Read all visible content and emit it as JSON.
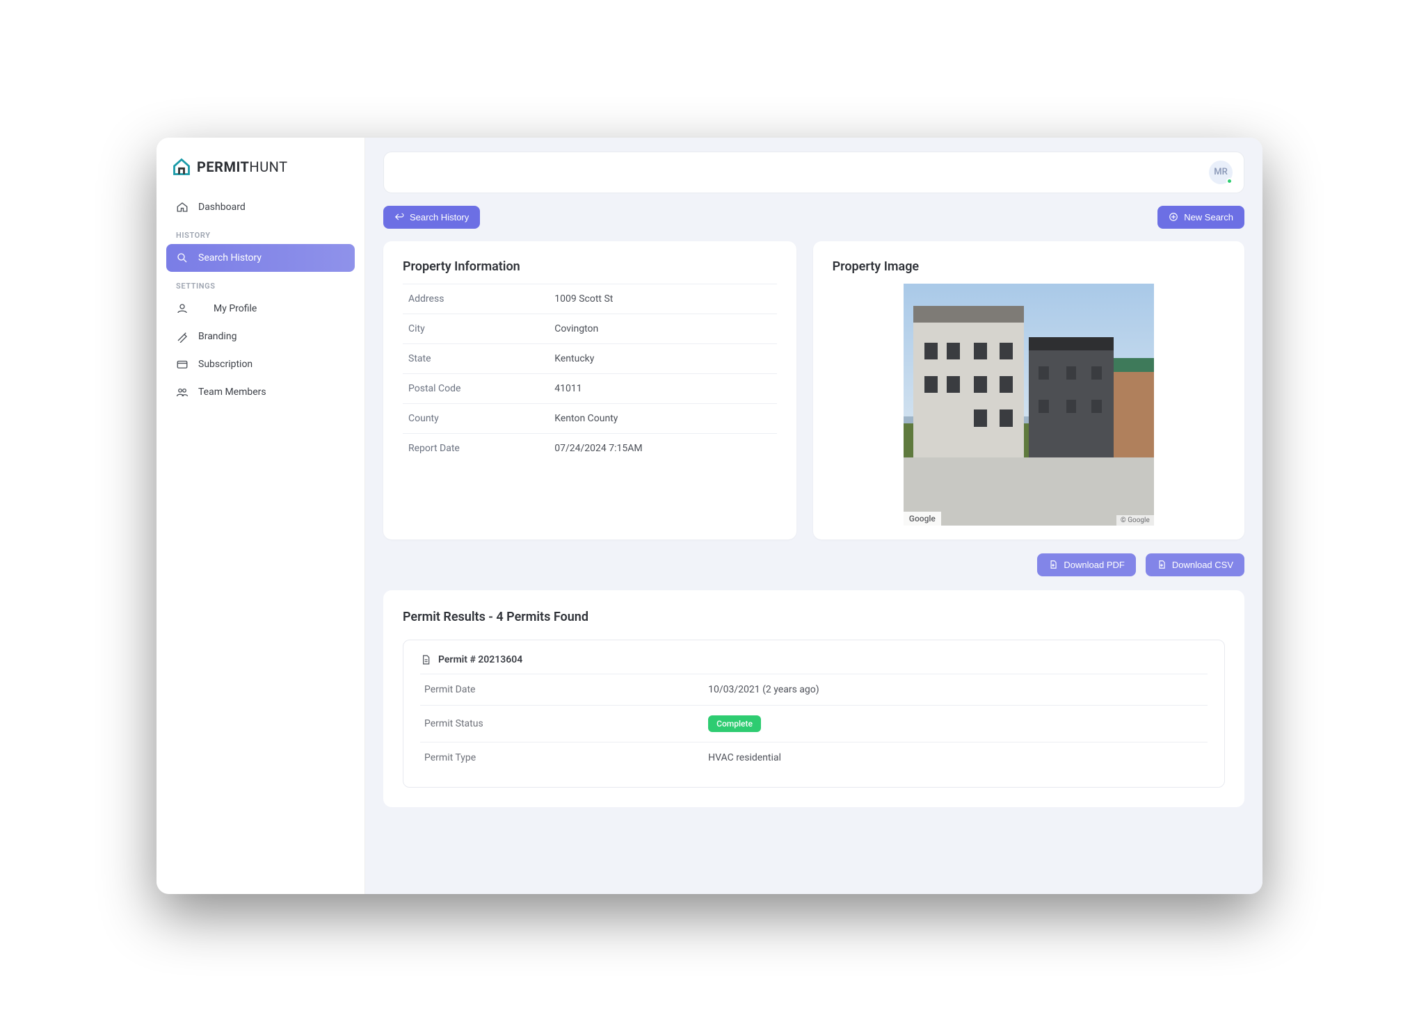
{
  "brand": {
    "name_bold": "PERMIT",
    "name_thin": "HUNT"
  },
  "avatar": {
    "initials": "MR"
  },
  "nav": {
    "dashboard": "Dashboard",
    "history_label": "HISTORY",
    "search_history": "Search History",
    "settings_label": "SETTINGS",
    "my_profile": "My Profile",
    "branding": "Branding",
    "subscription": "Subscription",
    "team_members": "Team Members"
  },
  "actions": {
    "back_search_history": "Search History",
    "new_search": "New Search",
    "download_pdf": "Download PDF",
    "download_csv": "Download CSV"
  },
  "property_info": {
    "title": "Property Information",
    "rows": [
      {
        "label": "Address",
        "value": "1009 Scott St"
      },
      {
        "label": "City",
        "value": "Covington"
      },
      {
        "label": "State",
        "value": "Kentucky"
      },
      {
        "label": "Postal Code",
        "value": "41011"
      },
      {
        "label": "County",
        "value": "Kenton County"
      },
      {
        "label": "Report Date",
        "value": "07/24/2024 7:15AM"
      }
    ]
  },
  "property_image": {
    "title": "Property Image",
    "google_badge": "Google",
    "copyright_badge": "© Google"
  },
  "results": {
    "title": "Permit Results - 4 Permits Found",
    "permit_number_label": "Permit # 20213604",
    "rows": [
      {
        "label": "Permit Date",
        "value": "10/03/2021 (2 years ago)",
        "type": "text"
      },
      {
        "label": "Permit Status",
        "value": "Complete",
        "type": "badge"
      },
      {
        "label": "Permit Type",
        "value": "HVAC residential",
        "type": "text"
      }
    ]
  }
}
